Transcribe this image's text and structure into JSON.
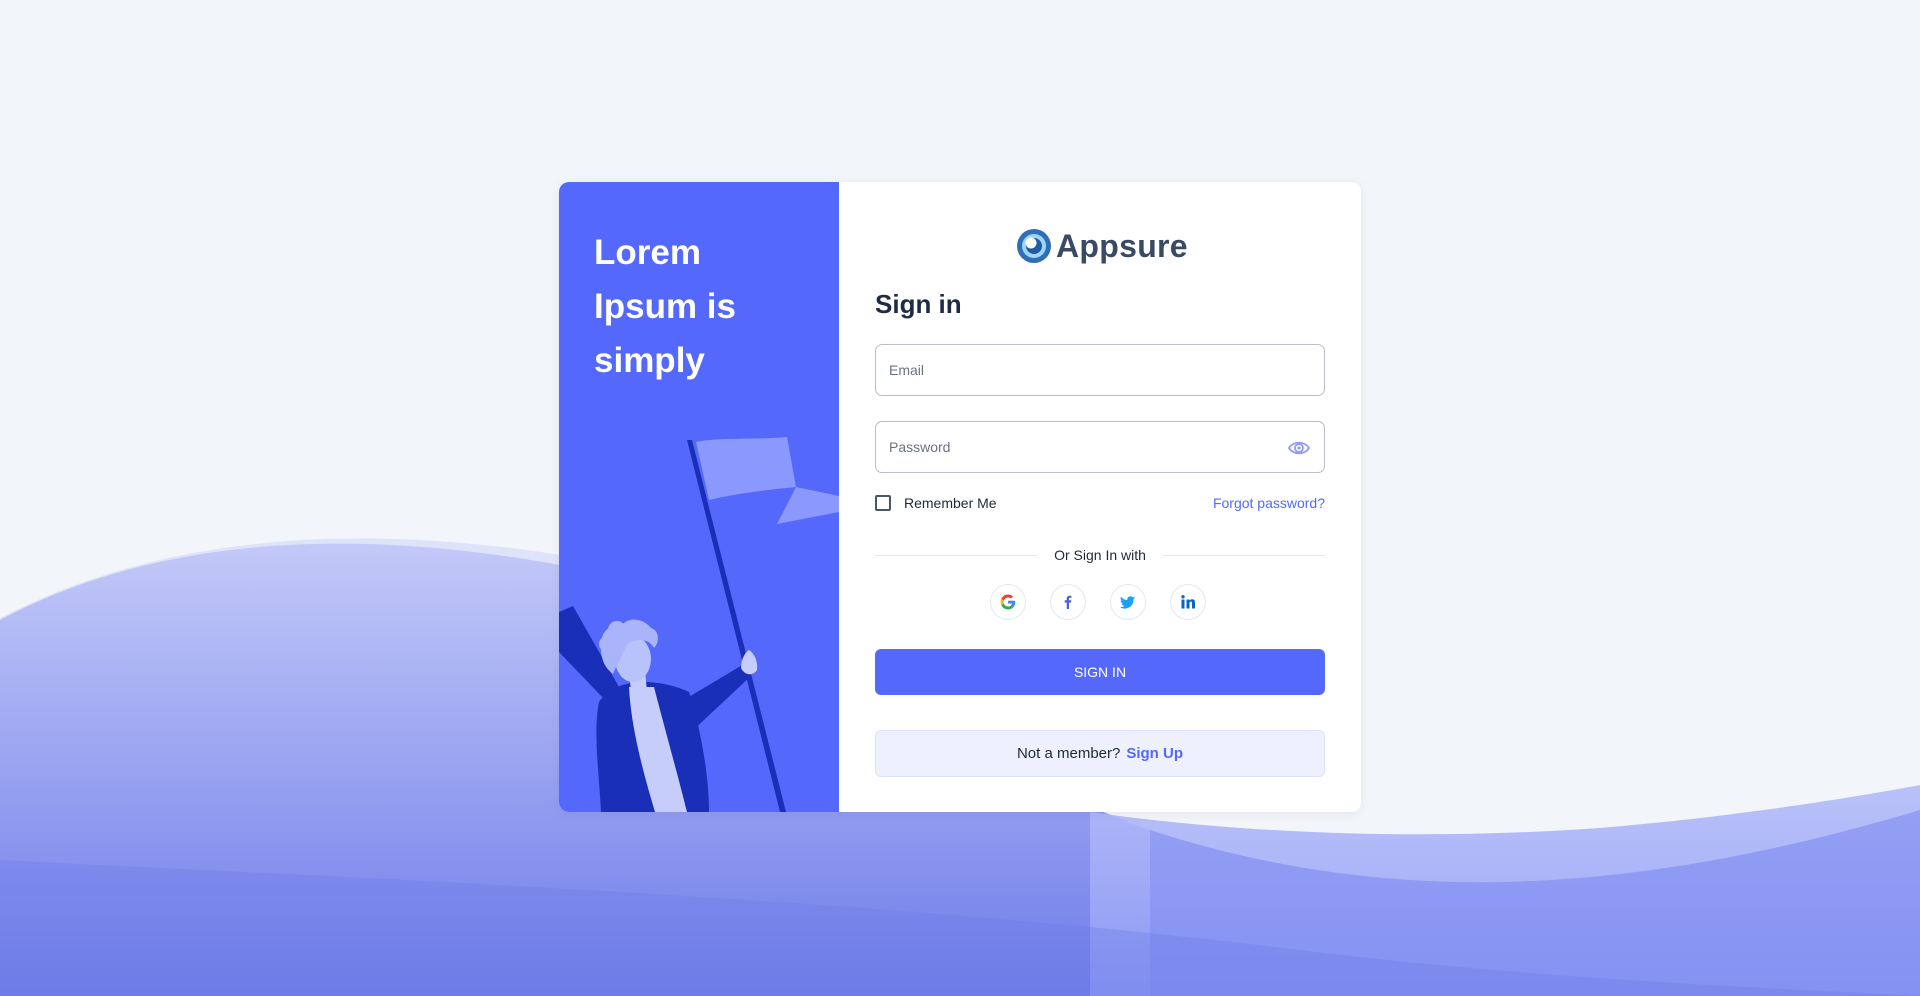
{
  "colors": {
    "accent": "#5469fb",
    "page_background": "#f2f5f9",
    "card_background": "#ffffff",
    "member_box_background": "#eef0fe"
  },
  "promo": {
    "headline": "Lorem\nIpsum is\nsimply"
  },
  "brand": {
    "logo_text": "Appsure",
    "logo_icon": "appsure-logo-icon"
  },
  "form": {
    "title": "Sign in",
    "email": {
      "placeholder": "Email",
      "value": ""
    },
    "password": {
      "placeholder": "Password",
      "value": "",
      "toggle_icon": "eye-icon"
    },
    "remember_label": "Remember Me",
    "remember_checked": false,
    "forgot_label": "Forgot password?",
    "social_divider": "Or Sign In with",
    "social": [
      {
        "icon": "google-icon"
      },
      {
        "icon": "facebook-icon"
      },
      {
        "icon": "twitter-icon"
      },
      {
        "icon": "linkedin-icon"
      }
    ],
    "submit_label": "SIGN IN",
    "member_prompt": "Not a member?",
    "signup_label": "Sign Up"
  }
}
